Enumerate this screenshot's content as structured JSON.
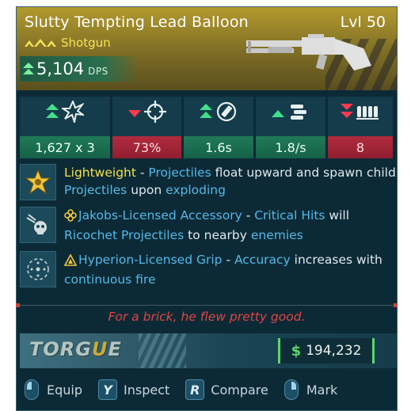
{
  "item": {
    "name": "Slutty Tempting Lead Balloon",
    "level": "Lvl 50",
    "type": "Shotgun",
    "dps_value": "5,104",
    "dps_unit": "DPS"
  },
  "colors": {
    "header_gold": "#b39a2e",
    "good_green": "#1f7a57",
    "bad_red": "#b22b3e",
    "perk_blue": "#55b8e8",
    "perk_yellow": "#f2e14a",
    "flavor_red": "#e04545",
    "money_green": "#5bd86c"
  },
  "stats": [
    {
      "name": "damage",
      "icon": "explosion-icon",
      "trend": "up",
      "value": "1,627 x 3"
    },
    {
      "name": "accuracy",
      "icon": "crosshair-icon",
      "trend": "down",
      "value": "73%"
    },
    {
      "name": "reload",
      "icon": "reload-icon",
      "trend": "up",
      "value": "1.6s"
    },
    {
      "name": "fire-rate",
      "icon": "bullets-icon",
      "trend": "up",
      "value": "1.8/s"
    },
    {
      "name": "magazine",
      "icon": "magazine-icon",
      "trend": "down2",
      "value": "8"
    }
  ],
  "perks": [
    {
      "icon": "star-badge-icon",
      "parts": [
        {
          "t": "Lightweight",
          "c": "yellow"
        },
        {
          "t": " - ",
          "c": "white"
        },
        {
          "t": "Projectiles",
          "c": "blue"
        },
        {
          "t": " float upward and spawn child ",
          "c": "white"
        },
        {
          "t": "Projectiles",
          "c": "blue"
        },
        {
          "t": " upon ",
          "c": "white"
        },
        {
          "t": "exploding",
          "c": "blue"
        }
      ]
    },
    {
      "icon": "skull-ricochet-icon",
      "inline_icon": "jakobs-flower-icon",
      "parts": [
        {
          "t": "Jakobs-Licensed Accessory",
          "c": "blue"
        },
        {
          "t": " - ",
          "c": "white"
        },
        {
          "t": "Critical Hits",
          "c": "blue"
        },
        {
          "t": " will ",
          "c": "white"
        },
        {
          "t": "Ricochet Projectiles",
          "c": "blue"
        },
        {
          "t": " to nearby ",
          "c": "white"
        },
        {
          "t": "enemies",
          "c": "blue"
        }
      ]
    },
    {
      "icon": "reticle-grip-icon",
      "inline_icon": "hyperion-triangle-icon",
      "parts": [
        {
          "t": "Hyperion-Licensed Grip",
          "c": "blue"
        },
        {
          "t": " - ",
          "c": "white"
        },
        {
          "t": "Accuracy",
          "c": "blue"
        },
        {
          "t": " increases with ",
          "c": "white"
        },
        {
          "t": "continuous fire",
          "c": "blue"
        }
      ]
    }
  ],
  "flavor_text": "For a brick, he flew pretty good.",
  "manufacturer": {
    "logo_main": "TORG",
    "logo_alt": "U",
    "logo_end": "E"
  },
  "price": {
    "symbol": "$",
    "value": "194,232"
  },
  "actions": [
    {
      "key": "mouse-left",
      "label": "Equip"
    },
    {
      "key": "Y",
      "label": "Inspect"
    },
    {
      "key": "R",
      "label": "Compare"
    },
    {
      "key": "mouse-right",
      "label": "Mark"
    }
  ]
}
